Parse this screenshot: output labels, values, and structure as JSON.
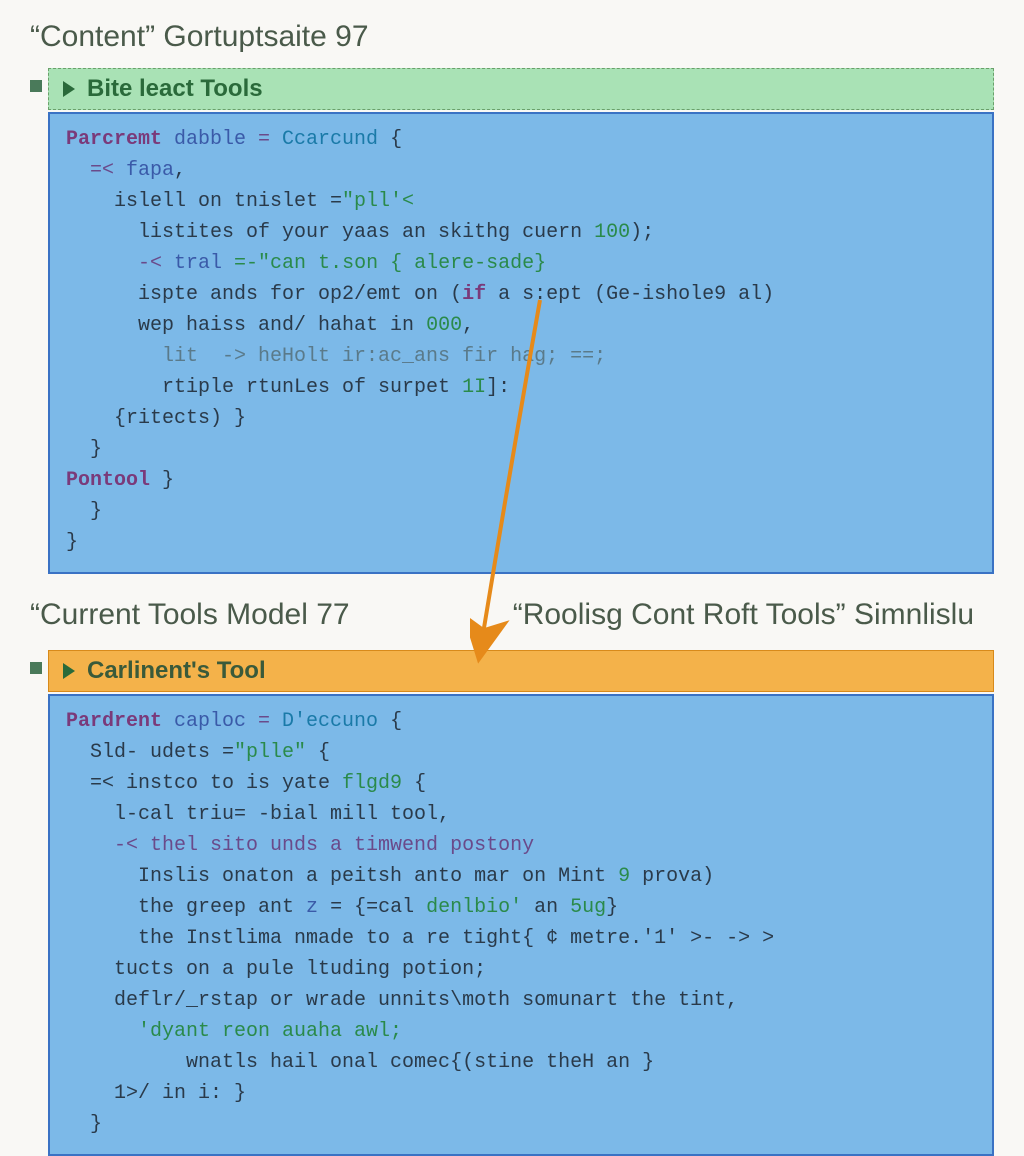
{
  "top": {
    "title": "“Content” Gortuptsaite 97",
    "panel_label": "Bite leact Tools",
    "code": {
      "l1a": "Parcremt",
      "l1b": " dabble ",
      "l1c": "= ",
      "l1d": "Ccarcund",
      "l1e": " {",
      "l2a": "  =< ",
      "l2b": "fapa",
      "l2c": ",",
      "l3a": "    islell on tnislet =",
      "l3b": "\"pll'<",
      "l4a": "      listites of your yaas an skithg cuern ",
      "l4b": "100",
      "l4c": ");",
      "l5a": "      -< ",
      "l5b": "tral",
      "l5c": " =-\"can t.son { alere-sade}",
      "l6a": "      ispte ands for op2/emt on (",
      "l6b": "if",
      "l6c": " a s:ept (Ge-ishole9 al)",
      "l7a": "      wep haiss and/ hahat in ",
      "l7b": "000",
      "l7c": ",",
      "l8a": "        lit  -> heHolt ir:ac_ans fir hag; ==;",
      "l9a": "        rtiple rtunLes of surpet ",
      "l9b": "1I",
      "l9c": "]:",
      "l10": "    {ritects) }",
      "l11": "  }",
      "l12a": "Pontool",
      "l12b": " }",
      "l13": "  }",
      "l14": "}"
    }
  },
  "mid": {
    "left_title": "“Current Tools Model 77",
    "right_title": "“Roolisg Cont Roft Tools” Simnlislu"
  },
  "bottom": {
    "panel_label": "Carlinent's Tool",
    "code": {
      "l1a": "Pardrent",
      "l1b": " caploc ",
      "l1c": "= ",
      "l1d": "D'eccuno",
      "l1e": " {",
      "l2a": "  Sld- udets =",
      "l2b": "\"plle\"",
      "l2c": " {",
      "l3a": "  =< instco to is yate ",
      "l3b": "flgd9",
      "l3c": " {",
      "l4a": "    l-cal triu= -bial mill tool,",
      "l5a": "    -< thel sito unds a timwend postony",
      "l6a": "      Inslis onaton a peitsh anto mar on Mint ",
      "l6b": "9",
      "l6c": " prova)",
      "l7a": "      the greep ant ",
      "l7b": "z",
      "l7c": " = {=cal ",
      "l7d": "denlbio'",
      "l7e": " an ",
      "l7f": "5ug",
      "l7g": "}",
      "l8a": "      the Instlima nmade to a re tight{ ¢ metre.'1' >- -> >",
      "l9a": "    tucts on a pule ltuding potion;",
      "l10a": "    deflr/_rstap or wrade unnits\\moth somunart the tint,",
      "l11a": "      'dyant reon auaha awl;",
      "l12a": "          wnatls hail onal comec{(stine theH an }",
      "l13a": "    1>/ in i: }",
      "l14": "  }"
    }
  }
}
